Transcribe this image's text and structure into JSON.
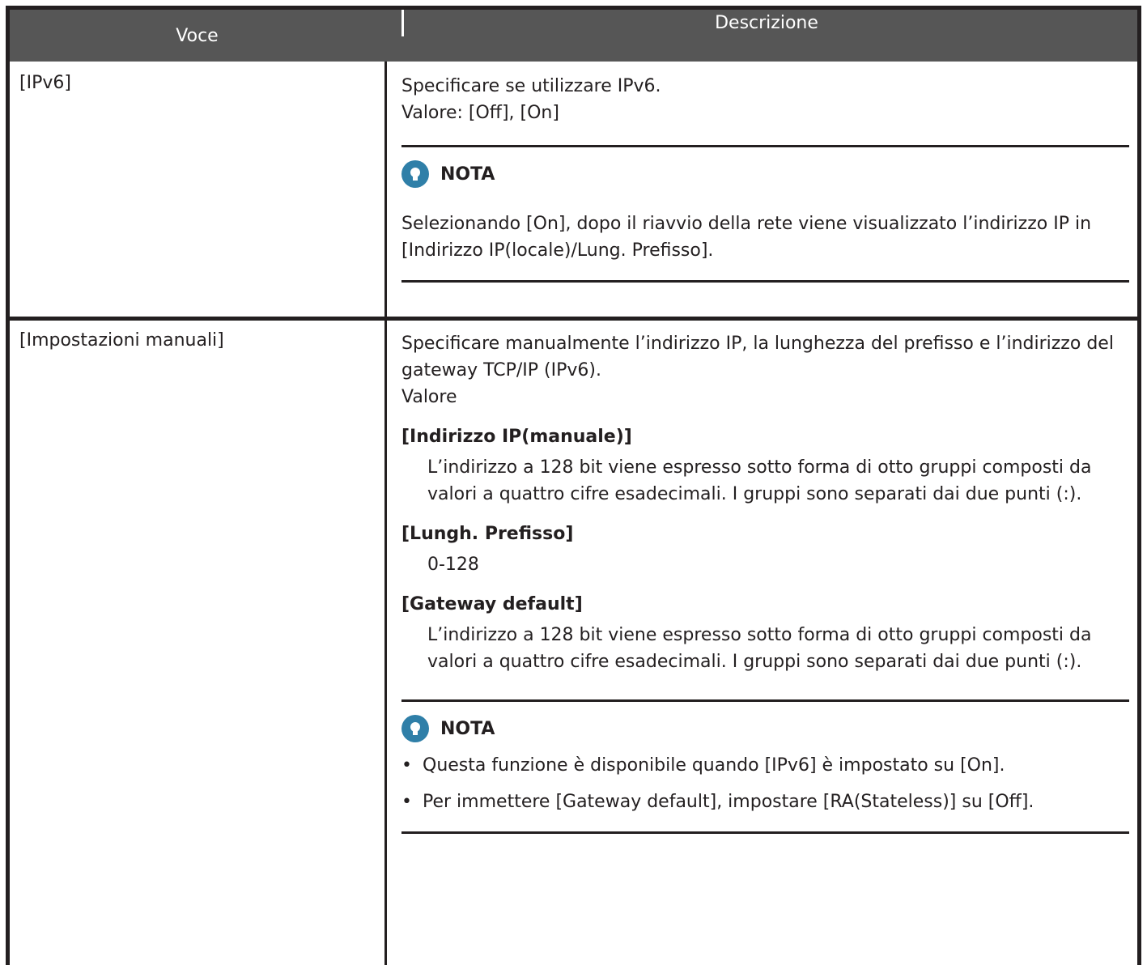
{
  "header": {
    "col1": "Voce",
    "col2": "Descrizione"
  },
  "rows": [
    {
      "item": "[IPv6]",
      "desc": [
        "Specificare se utilizzare IPv6.",
        "Valore: [Off], [On]"
      ],
      "note": {
        "title": "NOTA",
        "text": "Selezionando [On], dopo il riavvio della rete viene visualizzato l’indirizzo IP in [Indirizzo IP(locale)/Lung. Prefisso]."
      }
    },
    {
      "item": "[Impostazioni manuali]",
      "desc": [
        "Specificare manualmente l’indirizzo IP, la lunghezza del prefisso e l’indirizzo del gateway TCP/IP (IPv6).",
        "Valore"
      ],
      "values": [
        {
          "label": "[Indirizzo IP(manuale)]",
          "text": "L’indirizzo a 128 bit viene espresso sotto forma di otto gruppi composti da valori a quattro cifre esadecimali. I gruppi sono separati dai due punti (:)."
        },
        {
          "label": "[Lungh. Prefisso]",
          "text": "0-128"
        },
        {
          "label": "[Gateway default]",
          "text": "L’indirizzo a 128 bit viene espresso sotto forma di otto gruppi composti da valori a quattro cifre esadecimali. I gruppi sono separati dai due punti (:)."
        }
      ],
      "note": {
        "title": "NOTA",
        "bullets": [
          "Questa funzione è disponibile quando [IPv6] è impostato su [On].",
          "Per immettere [Gateway default], impostare [RA(Stateless)] su [Off]."
        ]
      }
    }
  ],
  "icon": "lightbulb-note-icon"
}
